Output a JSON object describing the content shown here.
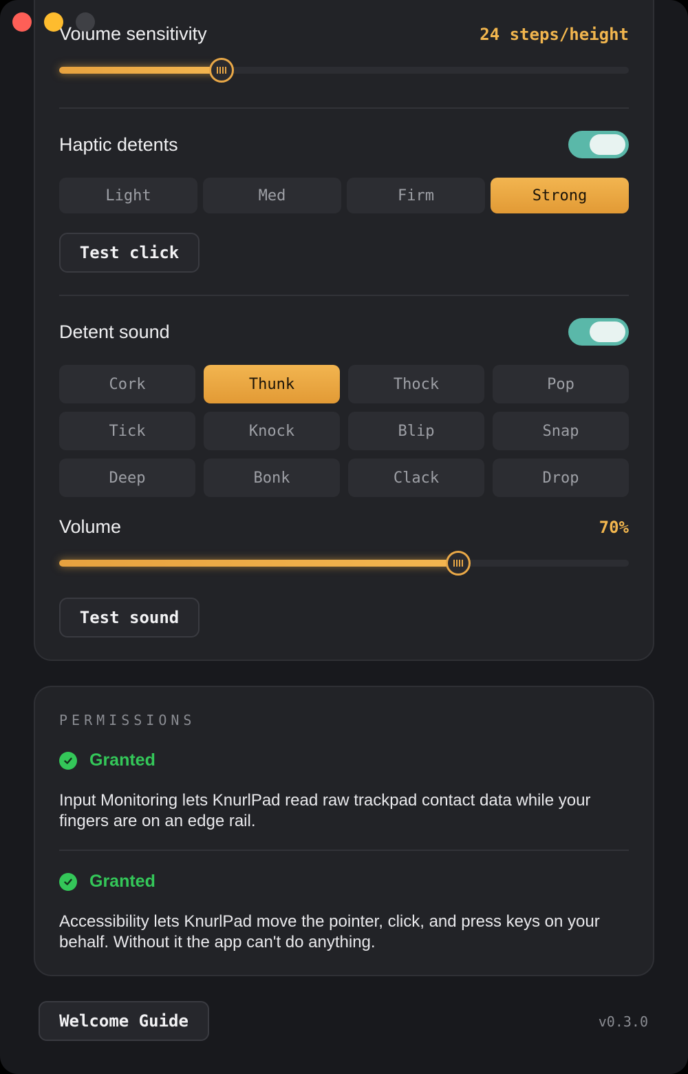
{
  "window": {
    "controls": [
      "close",
      "minimize",
      "zoom"
    ]
  },
  "volume_sensitivity": {
    "label": "Volume sensitivity",
    "value_text": "24 steps/height",
    "slider_fraction": 0.285
  },
  "haptic": {
    "label": "Haptic detents",
    "enabled": true,
    "options": [
      "Light",
      "Med",
      "Firm",
      "Strong"
    ],
    "selected": "Strong",
    "test_button": "Test click"
  },
  "detent_sound": {
    "label": "Detent sound",
    "enabled": true,
    "options": [
      "Cork",
      "Thunk",
      "Thock",
      "Pop",
      "Tick",
      "Knock",
      "Blip",
      "Snap",
      "Deep",
      "Bonk",
      "Clack",
      "Drop"
    ],
    "selected": "Thunk",
    "volume_label": "Volume",
    "volume_text": "70%",
    "volume_fraction": 0.7,
    "test_button": "Test sound"
  },
  "permissions": {
    "title": "PERMISSIONS",
    "items": [
      {
        "status": "Granted",
        "description": "Input Monitoring lets KnurlPad read raw trackpad contact data while your fingers are on an edge rail."
      },
      {
        "status": "Granted",
        "description": "Accessibility lets KnurlPad move the pointer, click, and press keys on your behalf. Without it the app can't do anything."
      }
    ]
  },
  "footer": {
    "welcome_button": "Welcome Guide",
    "version": "v0.3.0"
  },
  "colors": {
    "accent": "#f2b550",
    "toggle_on": "#5ab8a9",
    "granted": "#34c759"
  }
}
